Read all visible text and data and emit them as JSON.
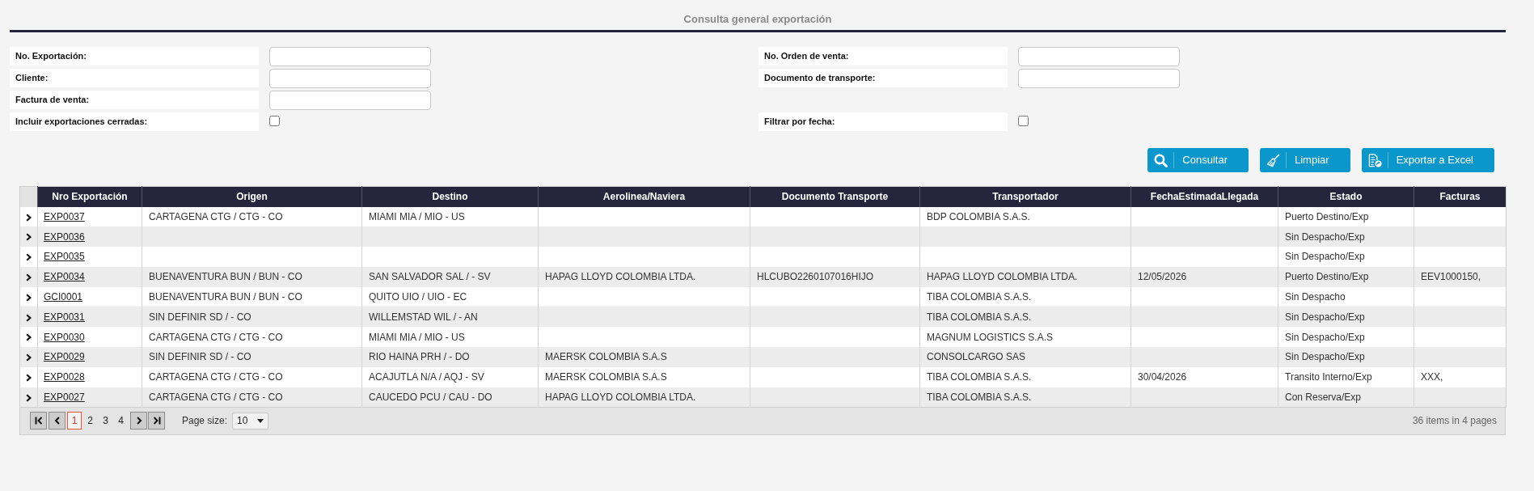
{
  "title": "Consulta general exportación",
  "filters": [
    {
      "left": {
        "label": "No. Exportación:",
        "kind": "text"
      },
      "right": {
        "label": "No. Orden de venta:",
        "kind": "text"
      }
    },
    {
      "left": {
        "label": "Cliente:",
        "kind": "text"
      },
      "right": {
        "label": "Documento de transporte:",
        "kind": "text"
      }
    },
    {
      "left": {
        "label": "Factura de venta:",
        "kind": "text"
      }
    },
    {
      "left": {
        "label": "Incluir exportaciones cerradas:",
        "kind": "checkbox",
        "checked": false
      },
      "right": {
        "label": "Filtrar por fecha:",
        "kind": "checkbox",
        "checked": false
      }
    }
  ],
  "buttons": [
    {
      "label": "Consultar",
      "kind": "search"
    },
    {
      "label": "Limpiar",
      "kind": "clear"
    },
    {
      "label": "Exportar a Excel",
      "kind": "export"
    }
  ],
  "table": {
    "columns": [
      "Nro Exportación",
      "Origen",
      "Destino",
      "Aerolinea/Naviera",
      "Documento Transporte",
      "Transportador",
      "FechaEstimadaLlegada",
      "Estado",
      "Facturas"
    ],
    "rows": [
      {
        "expanded": false,
        "cells": [
          "EXP0037",
          "CARTAGENA CTG / CTG - CO",
          "MIAMI MIA / MIO - US",
          null,
          null,
          "BDP COLOMBIA S.A.S.",
          null,
          "Puerto Destino/Exp",
          null
        ]
      },
      {
        "expanded": false,
        "cells": [
          "EXP0036",
          null,
          null,
          null,
          null,
          null,
          null,
          "Sin Despacho/Exp",
          null
        ]
      },
      {
        "expanded": false,
        "cells": [
          "EXP0035",
          null,
          null,
          null,
          null,
          null,
          null,
          "Sin Despacho/Exp",
          null
        ]
      },
      {
        "expanded": false,
        "cells": [
          "EXP0034",
          "BUENAVENTURA BUN / BUN - CO",
          "SAN SALVADOR SAL / - SV",
          "HAPAG LLOYD COLOMBIA LTDA.",
          "HLCUBO2260107016HIJO",
          "HAPAG LLOYD COLOMBIA LTDA.",
          "12/05/2026",
          "Puerto Destino/Exp",
          "EEV1000150,"
        ]
      },
      {
        "expanded": false,
        "cells": [
          "GCI0001",
          "BUENAVENTURA BUN / BUN - CO",
          "QUITO UIO / UIO - EC",
          null,
          null,
          "TIBA COLOMBIA S.A.S.",
          null,
          "Sin Despacho",
          null
        ]
      },
      {
        "expanded": false,
        "cells": [
          "EXP0031",
          "SIN DEFINIR SD / - CO",
          "WILLEMSTAD WIL / - AN",
          null,
          null,
          "TIBA COLOMBIA S.A.S.",
          null,
          "Sin Despacho/Exp",
          null
        ]
      },
      {
        "expanded": false,
        "cells": [
          "EXP0030",
          "CARTAGENA CTG / CTG - CO",
          "MIAMI MIA / MIO - US",
          null,
          null,
          "MAGNUM LOGISTICS S.A.S",
          null,
          "Sin Despacho/Exp",
          null
        ]
      },
      {
        "expanded": false,
        "cells": [
          "EXP0029",
          "SIN DEFINIR SD / - CO",
          "RIO HAINA PRH / - DO",
          "MAERSK COLOMBIA S.A.S",
          null,
          "CONSOLCARGO SAS",
          null,
          "Sin Despacho/Exp",
          null
        ]
      },
      {
        "expanded": false,
        "cells": [
          "EXP0028",
          "CARTAGENA CTG / CTG - CO",
          "ACAJUTLA N/A / AQJ - SV",
          "MAERSK COLOMBIA S.A.S",
          null,
          "TIBA COLOMBIA S.A.S.",
          "30/04/2026",
          "Transito Interno/Exp",
          "XXX,"
        ]
      },
      {
        "expanded": false,
        "cells": [
          "EXP0027",
          "CARTAGENA CTG / CTG - CO",
          "CAUCEDO PCU / CAU - DO",
          "HAPAG LLOYD COLOMBIA LTDA.",
          null,
          "TIBA COLOMBIA S.A.S.",
          null,
          "Con Reserva/Exp",
          null
        ]
      }
    ]
  },
  "pager": {
    "pages": [
      {
        "label": "1",
        "selected": true
      },
      {
        "label": "2",
        "selected": false
      },
      {
        "label": "3",
        "selected": false
      },
      {
        "label": "4",
        "selected": false
      }
    ],
    "page_size_label": "Page size:",
    "page_size": "10",
    "summary": "36 items in 4 pages"
  }
}
